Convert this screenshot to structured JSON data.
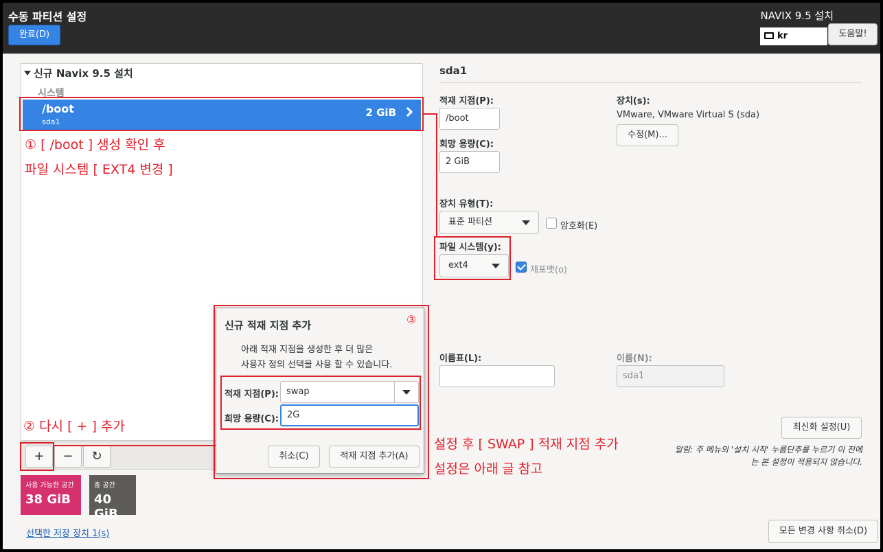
{
  "header": {
    "title": "수동 파티션 설정",
    "done_label": "완료(D)",
    "installer": "NAVIX 9.5 설치",
    "keyboard": "kr",
    "help_label": "도움말!"
  },
  "left": {
    "root_label": "신규 Navix 9.5 설치",
    "group_label": "시스템",
    "row": {
      "mount": "/boot",
      "device": "sda1",
      "size": "2 GiB"
    },
    "toolbar": {
      "add": "+",
      "remove": "−",
      "refresh": "↻"
    },
    "available": {
      "label": "사용 가능한 공간",
      "value": "38 GiB"
    },
    "total": {
      "label": "총 공간",
      "value": "40 GiB"
    },
    "storage_link": "선택한 저장 장치 1(s)"
  },
  "right": {
    "title": "sda1",
    "mount_label": "적재 지점(P):",
    "mount_value": "/boot",
    "capacity_label": "희망 용량(C):",
    "capacity_value": "2 GiB",
    "device_label": "장치(s):",
    "device_value": "VMware, VMware Virtual S (sda)",
    "modify_label": "수정(M)...",
    "device_type_label": "장치 유형(T):",
    "device_type_value": "표준 파티션",
    "encrypt_label": "암호화(E)",
    "fs_label": "파일 시스템(y):",
    "fs_value": "ext4",
    "reformat_label": "재포맷(o)",
    "label_label": "이름표(L):",
    "label_value": "",
    "name_label": "이름(N):",
    "name_value": "sda1",
    "update_label": "최신화 설정(U)",
    "note": "알림: 주 메뉴의 '설치 시작' 누름단추를 누르기 이 전에는 본 설정이 적용되지 않습니다.",
    "reset_label": "모든 변경 사항 취소(D)"
  },
  "dialog": {
    "title": "신규 적재 지점 추가",
    "desc_line1": "아래 적재 지점을 생성한 후 더 많은",
    "desc_line2": "사용자 정의 선택을 사용 할 수 있습니다.",
    "mount_label": "적재 지점(P):",
    "mount_value": "swap",
    "capacity_label": "희망 용량(C):",
    "capacity_value": "2G",
    "cancel_label": "취소(C)",
    "add_label": "적재 지점 추가(A)"
  },
  "annotations": {
    "a1_line1": "① [ /boot ] 생성 확인 후",
    "a1_line2": "파일 시스템 [ EXT4 변경 ]",
    "a2": "② 다시 [ + ] 추가",
    "a3": "③",
    "a4_line1": "설정 후 [ SWAP ] 적재 지점 추가",
    "a4_line2": "설정은 아래 글 참고"
  },
  "colors": {
    "accent": "#3584e4",
    "available_tile": "#d6316f",
    "total_tile": "#5e5c59",
    "annotation_red": "#e0202b"
  }
}
